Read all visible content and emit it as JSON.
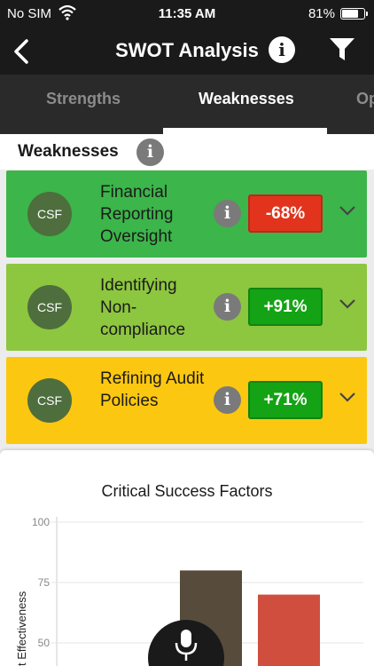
{
  "status": {
    "carrier": "No SIM",
    "time": "11:35 AM",
    "battery": "81%",
    "battery_level": 0.81
  },
  "nav": {
    "title": "SWOT Analysis"
  },
  "tabs": [
    {
      "label": "Strengths",
      "active": false
    },
    {
      "label": "Weaknesses",
      "active": true
    },
    {
      "label": "Op",
      "active": false
    }
  ],
  "section": {
    "title": "Weaknesses"
  },
  "cards": [
    {
      "badge": "CSF",
      "name": "Financial Reporting Oversight",
      "pct": "-68%",
      "bg": "#3cb54a",
      "pct_bg": "#e2341d"
    },
    {
      "badge": "CSF",
      "name": "Identifying Non-compliance",
      "pct": "+91%",
      "bg": "#8dc63f",
      "pct_bg": "#14a314"
    },
    {
      "badge": "CSF",
      "name": "Refining Audit Policies",
      "pct": "+71%",
      "bg": "#fcc710",
      "pct_bg": "#14a314"
    }
  ],
  "chart_data": {
    "type": "bar",
    "title": "Critical Success Factors",
    "ylabel": "t Effectiveness",
    "yticks": [
      100,
      75,
      50
    ],
    "ylim": [
      0,
      100
    ],
    "categories": [
      "",
      "",
      ""
    ],
    "values": [
      0,
      80,
      70
    ],
    "colors": [
      "#3d3d3d",
      "#574b3c",
      "#cf4e3e"
    ]
  },
  "colors": {
    "header": "#1a1a1a",
    "tabbar": "#2a2a2a",
    "csf_badge": "#4e6e3e"
  }
}
